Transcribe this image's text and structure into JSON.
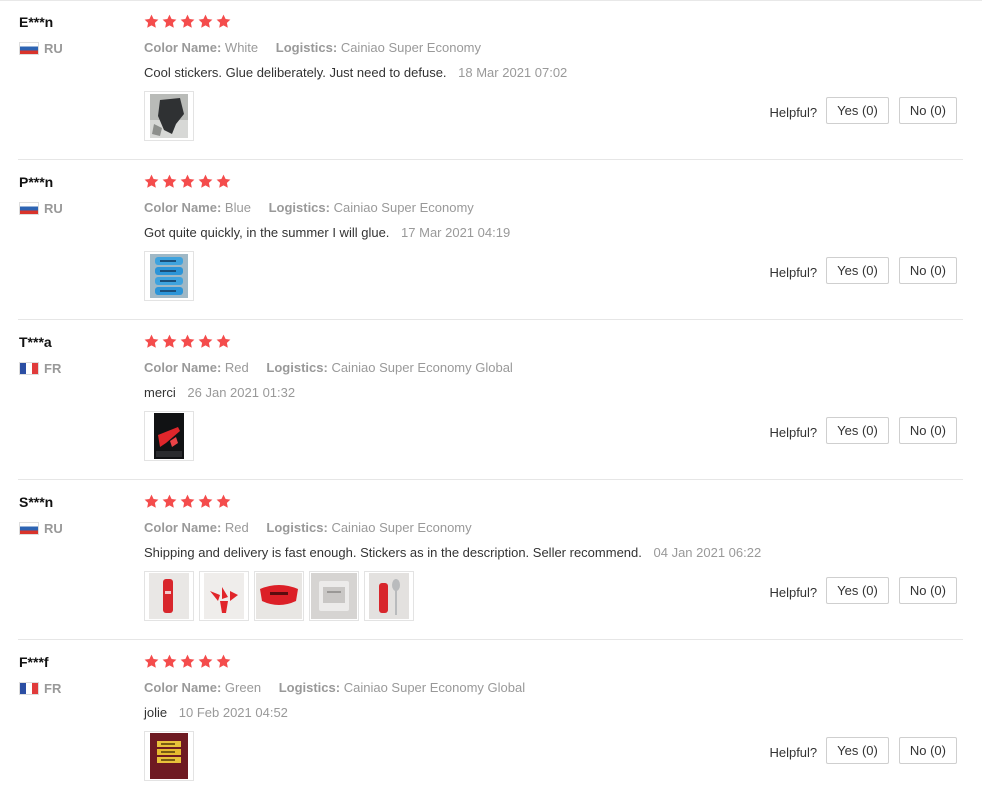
{
  "helpful_label": "Helpful?",
  "reviews": [
    {
      "user": "E***n",
      "country": "RU",
      "rating": 5,
      "color_label": "Color Name:",
      "color_value": "White",
      "logistics_label": "Logistics:",
      "logistics_value": "Cainiao Super Economy",
      "text": "Cool stickers. Glue deliberately. Just need to defuse.",
      "date": "18 Mar 2021 07:02",
      "photos": [
        "dark item on snowy ground"
      ],
      "yes": "Yes (0)",
      "no": "No (0)"
    },
    {
      "user": "P***n",
      "country": "RU",
      "rating": 5,
      "color_label": "Color Name:",
      "color_value": "Blue",
      "logistics_label": "Logistics:",
      "logistics_value": "Cainiao Super Economy",
      "text": "Got quite quickly, in the summer I will glue.",
      "date": "17 Mar 2021 04:19",
      "photos": [
        "blue stickers"
      ],
      "yes": "Yes (0)",
      "no": "No (0)"
    },
    {
      "user": "T***a",
      "country": "FR",
      "rating": 5,
      "color_label": "Color Name:",
      "color_value": "Red",
      "logistics_label": "Logistics:",
      "logistics_value": "Cainiao Super Economy Global",
      "text": "merci",
      "date": "26 Jan 2021 01:32",
      "photos": [
        "red sticker on black car"
      ],
      "yes": "Yes (0)",
      "no": "No (0)"
    },
    {
      "user": "S***n",
      "country": "RU",
      "rating": 5,
      "color_label": "Color Name:",
      "color_value": "Red",
      "logistics_label": "Logistics:",
      "logistics_value": "Cainiao Super Economy",
      "text": "Shipping and delivery is fast enough. Stickers as in the description. Seller recommend.",
      "date": "04 Jan 2021 06:22",
      "photos": [
        "red strip",
        "red pieces",
        "red sticker close-up",
        "package",
        "red strip with spoon"
      ],
      "yes": "Yes (0)",
      "no": "No (0)"
    },
    {
      "user": "F***f",
      "country": "FR",
      "rating": 5,
      "color_label": "Color Name:",
      "color_value": "Green",
      "logistics_label": "Logistics:",
      "logistics_value": "Cainiao Super Economy Global",
      "text": "jolie",
      "date": "10 Feb 2021 04:52",
      "photos": [
        "yellow stickers on maroon"
      ],
      "yes": "Yes (0)",
      "no": "No (0)"
    }
  ],
  "colors": {
    "star": "#f44c4c",
    "muted_text": "#999999",
    "body_text": "#333333",
    "divider": "#e6e6e6"
  }
}
